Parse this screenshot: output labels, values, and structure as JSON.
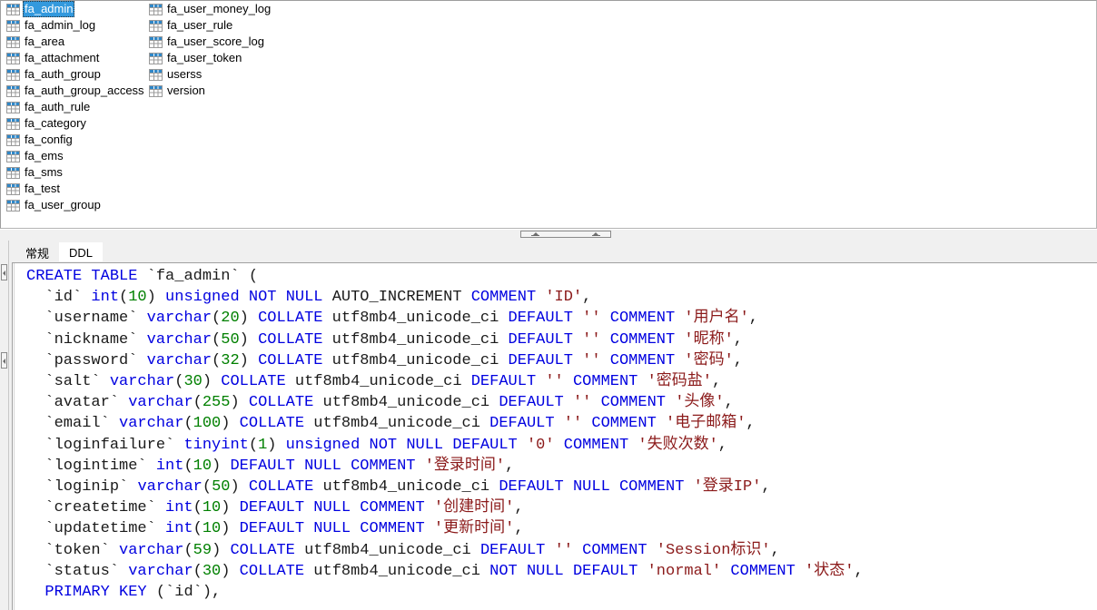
{
  "window": {
    "app": "database-ddl-viewer"
  },
  "table_list": {
    "selected": "fa_admin",
    "column1": [
      {
        "name": "fa_admin",
        "icon": "table-icon",
        "selected": true
      },
      {
        "name": "fa_admin_log",
        "icon": "table-icon",
        "selected": false
      },
      {
        "name": "fa_area",
        "icon": "table-icon",
        "selected": false
      },
      {
        "name": "fa_attachment",
        "icon": "table-icon",
        "selected": false
      },
      {
        "name": "fa_auth_group",
        "icon": "table-icon",
        "selected": false
      },
      {
        "name": "fa_auth_group_access",
        "icon": "table-icon",
        "selected": false
      },
      {
        "name": "fa_auth_rule",
        "icon": "table-icon",
        "selected": false
      },
      {
        "name": "fa_category",
        "icon": "table-icon",
        "selected": false
      },
      {
        "name": "fa_config",
        "icon": "table-icon",
        "selected": false
      },
      {
        "name": "fa_ems",
        "icon": "table-icon",
        "selected": false
      },
      {
        "name": "fa_sms",
        "icon": "table-icon",
        "selected": false
      },
      {
        "name": "fa_test",
        "icon": "table-icon",
        "selected": false
      },
      {
        "name": "fa_user_group",
        "icon": "table-icon",
        "selected": false
      }
    ],
    "column2": [
      {
        "name": "fa_user_money_log",
        "icon": "table-icon",
        "selected": false
      },
      {
        "name": "fa_user_rule",
        "icon": "table-icon",
        "selected": false
      },
      {
        "name": "fa_user_score_log",
        "icon": "table-icon",
        "selected": false
      },
      {
        "name": "fa_user_token",
        "icon": "table-icon",
        "selected": false
      },
      {
        "name": "userss",
        "icon": "table-icon",
        "selected": false
      },
      {
        "name": "version",
        "icon": "table-icon",
        "selected": false
      }
    ]
  },
  "tabs": [
    {
      "id": "general",
      "label": "常规",
      "active": false
    },
    {
      "id": "ddl",
      "label": "DDL",
      "active": true
    }
  ],
  "ddl": {
    "table_name": "fa_admin",
    "lines": [
      {
        "indent": 0,
        "tokens": [
          {
            "t": "CREATE",
            "c": "k"
          },
          {
            "t": " ",
            "c": "p"
          },
          {
            "t": "TABLE",
            "c": "k"
          },
          {
            "t": " `fa_admin` (",
            "c": "p"
          }
        ]
      },
      {
        "indent": 1,
        "tokens": [
          {
            "t": "`id` ",
            "c": "p"
          },
          {
            "t": "int",
            "c": "k"
          },
          {
            "t": "(",
            "c": "p"
          },
          {
            "t": "10",
            "c": "n"
          },
          {
            "t": ") ",
            "c": "p"
          },
          {
            "t": "unsigned",
            "c": "k"
          },
          {
            "t": " ",
            "c": "p"
          },
          {
            "t": "NOT",
            "c": "k"
          },
          {
            "t": " ",
            "c": "p"
          },
          {
            "t": "NULL",
            "c": "k"
          },
          {
            "t": " AUTO_INCREMENT ",
            "c": "p"
          },
          {
            "t": "COMMENT",
            "c": "k"
          },
          {
            "t": " ",
            "c": "p"
          },
          {
            "t": "'ID'",
            "c": "s"
          },
          {
            "t": ",",
            "c": "p"
          }
        ]
      },
      {
        "indent": 1,
        "tokens": [
          {
            "t": "`username` ",
            "c": "p"
          },
          {
            "t": "varchar",
            "c": "k"
          },
          {
            "t": "(",
            "c": "p"
          },
          {
            "t": "20",
            "c": "n"
          },
          {
            "t": ") ",
            "c": "p"
          },
          {
            "t": "COLLATE",
            "c": "k"
          },
          {
            "t": " utf8mb4_unicode_ci ",
            "c": "p"
          },
          {
            "t": "DEFAULT",
            "c": "k"
          },
          {
            "t": " ",
            "c": "p"
          },
          {
            "t": "''",
            "c": "s"
          },
          {
            "t": " ",
            "c": "p"
          },
          {
            "t": "COMMENT",
            "c": "k"
          },
          {
            "t": " ",
            "c": "p"
          },
          {
            "t": "'用户名'",
            "c": "s"
          },
          {
            "t": ",",
            "c": "p"
          }
        ]
      },
      {
        "indent": 1,
        "tokens": [
          {
            "t": "`nickname` ",
            "c": "p"
          },
          {
            "t": "varchar",
            "c": "k"
          },
          {
            "t": "(",
            "c": "p"
          },
          {
            "t": "50",
            "c": "n"
          },
          {
            "t": ") ",
            "c": "p"
          },
          {
            "t": "COLLATE",
            "c": "k"
          },
          {
            "t": " utf8mb4_unicode_ci ",
            "c": "p"
          },
          {
            "t": "DEFAULT",
            "c": "k"
          },
          {
            "t": " ",
            "c": "p"
          },
          {
            "t": "''",
            "c": "s"
          },
          {
            "t": " ",
            "c": "p"
          },
          {
            "t": "COMMENT",
            "c": "k"
          },
          {
            "t": " ",
            "c": "p"
          },
          {
            "t": "'昵称'",
            "c": "s"
          },
          {
            "t": ",",
            "c": "p"
          }
        ]
      },
      {
        "indent": 1,
        "tokens": [
          {
            "t": "`password` ",
            "c": "p"
          },
          {
            "t": "varchar",
            "c": "k"
          },
          {
            "t": "(",
            "c": "p"
          },
          {
            "t": "32",
            "c": "n"
          },
          {
            "t": ") ",
            "c": "p"
          },
          {
            "t": "COLLATE",
            "c": "k"
          },
          {
            "t": " utf8mb4_unicode_ci ",
            "c": "p"
          },
          {
            "t": "DEFAULT",
            "c": "k"
          },
          {
            "t": " ",
            "c": "p"
          },
          {
            "t": "''",
            "c": "s"
          },
          {
            "t": " ",
            "c": "p"
          },
          {
            "t": "COMMENT",
            "c": "k"
          },
          {
            "t": " ",
            "c": "p"
          },
          {
            "t": "'密码'",
            "c": "s"
          },
          {
            "t": ",",
            "c": "p"
          }
        ]
      },
      {
        "indent": 1,
        "tokens": [
          {
            "t": "`salt` ",
            "c": "p"
          },
          {
            "t": "varchar",
            "c": "k"
          },
          {
            "t": "(",
            "c": "p"
          },
          {
            "t": "30",
            "c": "n"
          },
          {
            "t": ") ",
            "c": "p"
          },
          {
            "t": "COLLATE",
            "c": "k"
          },
          {
            "t": " utf8mb4_unicode_ci ",
            "c": "p"
          },
          {
            "t": "DEFAULT",
            "c": "k"
          },
          {
            "t": " ",
            "c": "p"
          },
          {
            "t": "''",
            "c": "s"
          },
          {
            "t": " ",
            "c": "p"
          },
          {
            "t": "COMMENT",
            "c": "k"
          },
          {
            "t": " ",
            "c": "p"
          },
          {
            "t": "'密码盐'",
            "c": "s"
          },
          {
            "t": ",",
            "c": "p"
          }
        ]
      },
      {
        "indent": 1,
        "tokens": [
          {
            "t": "`avatar` ",
            "c": "p"
          },
          {
            "t": "varchar",
            "c": "k"
          },
          {
            "t": "(",
            "c": "p"
          },
          {
            "t": "255",
            "c": "n"
          },
          {
            "t": ") ",
            "c": "p"
          },
          {
            "t": "COLLATE",
            "c": "k"
          },
          {
            "t": " utf8mb4_unicode_ci ",
            "c": "p"
          },
          {
            "t": "DEFAULT",
            "c": "k"
          },
          {
            "t": " ",
            "c": "p"
          },
          {
            "t": "''",
            "c": "s"
          },
          {
            "t": " ",
            "c": "p"
          },
          {
            "t": "COMMENT",
            "c": "k"
          },
          {
            "t": " ",
            "c": "p"
          },
          {
            "t": "'头像'",
            "c": "s"
          },
          {
            "t": ",",
            "c": "p"
          }
        ]
      },
      {
        "indent": 1,
        "tokens": [
          {
            "t": "`email` ",
            "c": "p"
          },
          {
            "t": "varchar",
            "c": "k"
          },
          {
            "t": "(",
            "c": "p"
          },
          {
            "t": "100",
            "c": "n"
          },
          {
            "t": ") ",
            "c": "p"
          },
          {
            "t": "COLLATE",
            "c": "k"
          },
          {
            "t": " utf8mb4_unicode_ci ",
            "c": "p"
          },
          {
            "t": "DEFAULT",
            "c": "k"
          },
          {
            "t": " ",
            "c": "p"
          },
          {
            "t": "''",
            "c": "s"
          },
          {
            "t": " ",
            "c": "p"
          },
          {
            "t": "COMMENT",
            "c": "k"
          },
          {
            "t": " ",
            "c": "p"
          },
          {
            "t": "'电子邮箱'",
            "c": "s"
          },
          {
            "t": ",",
            "c": "p"
          }
        ]
      },
      {
        "indent": 1,
        "tokens": [
          {
            "t": "`loginfailure` ",
            "c": "p"
          },
          {
            "t": "tinyint",
            "c": "k"
          },
          {
            "t": "(",
            "c": "p"
          },
          {
            "t": "1",
            "c": "n"
          },
          {
            "t": ") ",
            "c": "p"
          },
          {
            "t": "unsigned",
            "c": "k"
          },
          {
            "t": " ",
            "c": "p"
          },
          {
            "t": "NOT",
            "c": "k"
          },
          {
            "t": " ",
            "c": "p"
          },
          {
            "t": "NULL",
            "c": "k"
          },
          {
            "t": " ",
            "c": "p"
          },
          {
            "t": "DEFAULT",
            "c": "k"
          },
          {
            "t": " ",
            "c": "p"
          },
          {
            "t": "'0'",
            "c": "s"
          },
          {
            "t": " ",
            "c": "p"
          },
          {
            "t": "COMMENT",
            "c": "k"
          },
          {
            "t": " ",
            "c": "p"
          },
          {
            "t": "'失败次数'",
            "c": "s"
          },
          {
            "t": ",",
            "c": "p"
          }
        ]
      },
      {
        "indent": 1,
        "tokens": [
          {
            "t": "`logintime` ",
            "c": "p"
          },
          {
            "t": "int",
            "c": "k"
          },
          {
            "t": "(",
            "c": "p"
          },
          {
            "t": "10",
            "c": "n"
          },
          {
            "t": ") ",
            "c": "p"
          },
          {
            "t": "DEFAULT",
            "c": "k"
          },
          {
            "t": " ",
            "c": "p"
          },
          {
            "t": "NULL",
            "c": "k"
          },
          {
            "t": " ",
            "c": "p"
          },
          {
            "t": "COMMENT",
            "c": "k"
          },
          {
            "t": " ",
            "c": "p"
          },
          {
            "t": "'登录时间'",
            "c": "s"
          },
          {
            "t": ",",
            "c": "p"
          }
        ]
      },
      {
        "indent": 1,
        "tokens": [
          {
            "t": "`loginip` ",
            "c": "p"
          },
          {
            "t": "varchar",
            "c": "k"
          },
          {
            "t": "(",
            "c": "p"
          },
          {
            "t": "50",
            "c": "n"
          },
          {
            "t": ") ",
            "c": "p"
          },
          {
            "t": "COLLATE",
            "c": "k"
          },
          {
            "t": " utf8mb4_unicode_ci ",
            "c": "p"
          },
          {
            "t": "DEFAULT",
            "c": "k"
          },
          {
            "t": " ",
            "c": "p"
          },
          {
            "t": "NULL",
            "c": "k"
          },
          {
            "t": " ",
            "c": "p"
          },
          {
            "t": "COMMENT",
            "c": "k"
          },
          {
            "t": " ",
            "c": "p"
          },
          {
            "t": "'登录IP'",
            "c": "s"
          },
          {
            "t": ",",
            "c": "p"
          }
        ]
      },
      {
        "indent": 1,
        "tokens": [
          {
            "t": "`createtime` ",
            "c": "p"
          },
          {
            "t": "int",
            "c": "k"
          },
          {
            "t": "(",
            "c": "p"
          },
          {
            "t": "10",
            "c": "n"
          },
          {
            "t": ") ",
            "c": "p"
          },
          {
            "t": "DEFAULT",
            "c": "k"
          },
          {
            "t": " ",
            "c": "p"
          },
          {
            "t": "NULL",
            "c": "k"
          },
          {
            "t": " ",
            "c": "p"
          },
          {
            "t": "COMMENT",
            "c": "k"
          },
          {
            "t": " ",
            "c": "p"
          },
          {
            "t": "'创建时间'",
            "c": "s"
          },
          {
            "t": ",",
            "c": "p"
          }
        ]
      },
      {
        "indent": 1,
        "tokens": [
          {
            "t": "`updatetime` ",
            "c": "p"
          },
          {
            "t": "int",
            "c": "k"
          },
          {
            "t": "(",
            "c": "p"
          },
          {
            "t": "10",
            "c": "n"
          },
          {
            "t": ") ",
            "c": "p"
          },
          {
            "t": "DEFAULT",
            "c": "k"
          },
          {
            "t": " ",
            "c": "p"
          },
          {
            "t": "NULL",
            "c": "k"
          },
          {
            "t": " ",
            "c": "p"
          },
          {
            "t": "COMMENT",
            "c": "k"
          },
          {
            "t": " ",
            "c": "p"
          },
          {
            "t": "'更新时间'",
            "c": "s"
          },
          {
            "t": ",",
            "c": "p"
          }
        ]
      },
      {
        "indent": 1,
        "tokens": [
          {
            "t": "`token` ",
            "c": "p"
          },
          {
            "t": "varchar",
            "c": "k"
          },
          {
            "t": "(",
            "c": "p"
          },
          {
            "t": "59",
            "c": "n"
          },
          {
            "t": ") ",
            "c": "p"
          },
          {
            "t": "COLLATE",
            "c": "k"
          },
          {
            "t": " utf8mb4_unicode_ci ",
            "c": "p"
          },
          {
            "t": "DEFAULT",
            "c": "k"
          },
          {
            "t": " ",
            "c": "p"
          },
          {
            "t": "''",
            "c": "s"
          },
          {
            "t": " ",
            "c": "p"
          },
          {
            "t": "COMMENT",
            "c": "k"
          },
          {
            "t": " ",
            "c": "p"
          },
          {
            "t": "'Session标识'",
            "c": "s"
          },
          {
            "t": ",",
            "c": "p"
          }
        ]
      },
      {
        "indent": 1,
        "tokens": [
          {
            "t": "`status` ",
            "c": "p"
          },
          {
            "t": "varchar",
            "c": "k"
          },
          {
            "t": "(",
            "c": "p"
          },
          {
            "t": "30",
            "c": "n"
          },
          {
            "t": ") ",
            "c": "p"
          },
          {
            "t": "COLLATE",
            "c": "k"
          },
          {
            "t": " utf8mb4_unicode_ci ",
            "c": "p"
          },
          {
            "t": "NOT",
            "c": "k"
          },
          {
            "t": " ",
            "c": "p"
          },
          {
            "t": "NULL",
            "c": "k"
          },
          {
            "t": " ",
            "c": "p"
          },
          {
            "t": "DEFAULT",
            "c": "k"
          },
          {
            "t": " ",
            "c": "p"
          },
          {
            "t": "'normal'",
            "c": "s"
          },
          {
            "t": " ",
            "c": "p"
          },
          {
            "t": "COMMENT",
            "c": "k"
          },
          {
            "t": " ",
            "c": "p"
          },
          {
            "t": "'状态'",
            "c": "s"
          },
          {
            "t": ",",
            "c": "p"
          }
        ]
      },
      {
        "indent": 1,
        "tokens": [
          {
            "t": "PRIMARY",
            "c": "k"
          },
          {
            "t": " ",
            "c": "p"
          },
          {
            "t": "KEY",
            "c": "k"
          },
          {
            "t": " (`id`),",
            "c": "p"
          }
        ]
      }
    ]
  },
  "colors": {
    "keyword": "#0000e0",
    "number": "#008000",
    "string": "#8b1a1a",
    "plain": "#1a1a1a",
    "selection": "#3399dd",
    "icon_header": "#2f87c8"
  }
}
